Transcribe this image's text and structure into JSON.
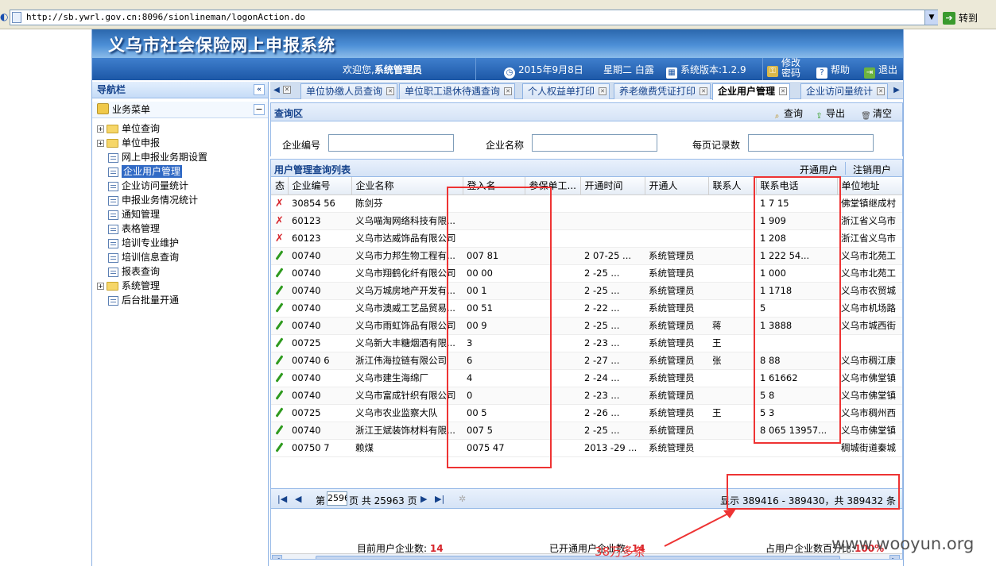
{
  "browser": {
    "url": "http://sb.ywrl.gov.cn:8096/sionlineman/logonAction.do",
    "go_label": "转到"
  },
  "app": {
    "title": "义乌市社会保险网上申报系统",
    "welcome_prefix": "欢迎您,",
    "user": "系统管理员",
    "date": "2015年9月8日",
    "weekday_weather": "星期二 白露",
    "version": "系统版本:1.2.9",
    "change_password": "修改密码",
    "help": "帮助",
    "logout": "退出"
  },
  "nav": {
    "header": "导航栏",
    "menu_title": "业务菜单",
    "items": [
      {
        "label": "单位查询",
        "type": "folder"
      },
      {
        "label": "单位申报",
        "type": "folder"
      },
      {
        "label": "网上申报业务期设置",
        "type": "leaf"
      },
      {
        "label": "企业用户管理",
        "type": "leaf",
        "selected": true
      },
      {
        "label": "企业访问量统计",
        "type": "leaf"
      },
      {
        "label": "申报业务情况统计",
        "type": "leaf"
      },
      {
        "label": "通知管理",
        "type": "leaf"
      },
      {
        "label": "表格管理",
        "type": "leaf"
      },
      {
        "label": "培训专业维护",
        "type": "leaf"
      },
      {
        "label": "培训信息查询",
        "type": "leaf"
      },
      {
        "label": "报表查询",
        "type": "leaf"
      },
      {
        "label": "系统管理",
        "type": "folder"
      },
      {
        "label": "后台批量开通",
        "type": "leaf"
      }
    ]
  },
  "tabs": [
    {
      "label": "单位协缴人员查询"
    },
    {
      "label": "单位职工退休待遇查询"
    },
    {
      "label": "个人权益单打印"
    },
    {
      "label": "养老缴费凭证打印"
    },
    {
      "label": "企业用户管理",
      "active": true
    },
    {
      "label": "企业访问量统计"
    }
  ],
  "query": {
    "title": "查询区",
    "search": "查询",
    "export": "导出",
    "clear": "清空",
    "label_code": "企业编号",
    "label_name": "企业名称",
    "label_page": "每页记录数"
  },
  "list": {
    "title": "用户管理查询列表",
    "open_user": "开通用户",
    "cancel_user": "注销用户",
    "columns": [
      "态",
      "企业编号",
      "企业名称",
      "登入名",
      "参保单工...",
      "开通时间",
      "开通人",
      "联系人",
      "联系电话",
      "单位地址"
    ],
    "rows": [
      {
        "status": "x",
        "code": "30854   56",
        "name": "陈剑芬",
        "login": "",
        "unit": "",
        "time": "",
        "opener": "",
        "contact": "",
        "phone": "1    7    15",
        "addr": "佛堂镇继成村"
      },
      {
        "status": "x",
        "code": "60123",
        "name": "义乌喵淘网络科技有限...",
        "login": "",
        "unit": "",
        "time": "",
        "opener": "",
        "contact": "",
        "phone": "1        909",
        "addr": "浙江省义乌市"
      },
      {
        "status": "x",
        "code": "60123",
        "name": "义乌市达威饰品有限公司",
        "login": "",
        "unit": "",
        "time": "",
        "opener": "",
        "contact": "",
        "phone": "1        208",
        "addr": "浙江省义乌市"
      },
      {
        "status": "ok",
        "code": "00740",
        "name": "义乌市力邦生物工程有...",
        "login": "007     81",
        "unit": "",
        "time": "2   07-25 ...",
        "opener": "系统管理员",
        "contact": "",
        "phone": "1     222 54...",
        "addr": "义乌市北苑工"
      },
      {
        "status": "ok",
        "code": "00740",
        "name": "义乌市翔鹤化纤有限公司",
        "login": "00      00",
        "unit": "",
        "time": "2    -25 ...",
        "opener": "系统管理员",
        "contact": "",
        "phone": "1       000",
        "addr": "义乌市北苑工"
      },
      {
        "status": "ok",
        "code": "00740",
        "name": "义乌万城房地产开发有...",
        "login": "00      1",
        "unit": "",
        "time": "2    -25 ...",
        "opener": "系统管理员",
        "contact": "",
        "phone": "1      1718",
        "addr": "义乌市农贸城"
      },
      {
        "status": "ok",
        "code": "00740",
        "name": "义乌市澳威工艺品贸易...",
        "login": "00      51",
        "unit": "",
        "time": "2    -22 ...",
        "opener": "系统管理员",
        "contact": "",
        "phone": "5",
        "addr": "义乌市机场路"
      },
      {
        "status": "ok",
        "code": "00740",
        "name": "义乌市雨虹饰品有限公司",
        "login": "00      9",
        "unit": "",
        "time": "2    -25 ...",
        "opener": "系统管理员",
        "contact": "蒋",
        "phone": "1      3888",
        "addr": "义乌市城西街"
      },
      {
        "status": "ok",
        "code": "00725",
        "name": "义乌新大丰糖烟酒有限...",
        "login": "        3",
        "unit": "",
        "time": "2    -23 ...",
        "opener": "系统管理员",
        "contact": "王",
        "phone": "",
        "addr": ""
      },
      {
        "status": "ok",
        "code": "00740   6",
        "name": "浙江伟海拉链有限公司",
        "login": "        6",
        "unit": "",
        "time": "2    -27 ...",
        "opener": "系统管理员",
        "contact": "张",
        "phone": "8     88",
        "addr": "义乌市稠江康"
      },
      {
        "status": "ok",
        "code": "00740",
        "name": "义乌市建生海绵厂",
        "login": "        4",
        "unit": "",
        "time": "2    -24 ...",
        "opener": "系统管理员",
        "contact": "",
        "phone": "1     61662",
        "addr": "义乌市佛堂镇"
      },
      {
        "status": "ok",
        "code": "00740",
        "name": "义乌市富成针织有限公司",
        "login": "0",
        "unit": "",
        "time": "2    -23 ...",
        "opener": "系统管理员",
        "contact": "",
        "phone": "5     8",
        "addr": "义乌市佛堂镇"
      },
      {
        "status": "ok",
        "code": "00725",
        "name": "义乌市农业监察大队",
        "login": "00      5",
        "unit": "",
        "time": "2    -26 ...",
        "opener": "系统管理员",
        "contact": "王",
        "phone": "5     3",
        "addr": "义乌市稠州西"
      },
      {
        "status": "ok",
        "code": "00740",
        "name": "浙江王斌装饰材料有限...",
        "login": "007     5",
        "unit": "",
        "time": "2    -25 ...",
        "opener": "系统管理员",
        "contact": "",
        "phone": "8    065 13957...",
        "addr": "义乌市佛堂镇"
      },
      {
        "status": "ok",
        "code": "00750   7",
        "name": "赖煤",
        "login": "0075    47",
        "unit": "",
        "time": "2013   -29 ...",
        "opener": "系统管理员",
        "contact": "",
        "phone": "",
        "addr": "稠城街道秦城"
      }
    ]
  },
  "pager": {
    "page_prefix": "第",
    "page_value": "2596",
    "page_suffix": "页 共 25963 页",
    "info": "显示 389416 - 389430，共 389432 条"
  },
  "stats": {
    "current_label": "目前用户企业数:",
    "current_value": "14",
    "opened_label": "已开通用户企业数:",
    "opened_value": "14",
    "ratio_label": "占用户企业数百分比:",
    "ratio_value": "100%"
  },
  "annotation": "38万多条",
  "watermark": "www.wooyun.org",
  "colors": {
    "accent": "#1c57a6",
    "highlight": "#e33333",
    "status_bad": "#d6242a",
    "status_ok": "#2e9a1e"
  }
}
